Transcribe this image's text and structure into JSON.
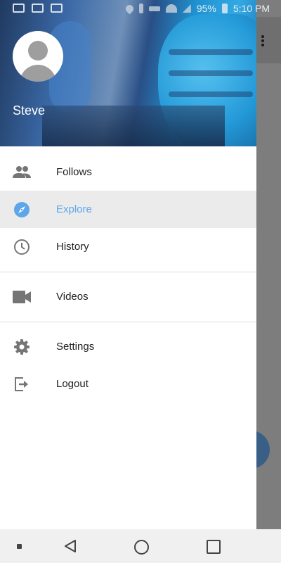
{
  "status_bar": {
    "battery": "95%",
    "time": "5:10 PM",
    "left_icons": [
      "cast-icon",
      "youtube-icon",
      "activity-icon"
    ],
    "right_icons": [
      "location-icon",
      "bluetooth-icon",
      "vpn-key-icon",
      "wifi-icon",
      "signal-icon",
      "battery-icon"
    ]
  },
  "drawer": {
    "user_name": "Steve",
    "menu": [
      {
        "label": "Follows",
        "icon": "people-icon",
        "active": false
      },
      {
        "label": "Explore",
        "icon": "compass-icon",
        "active": true
      },
      {
        "label": "History",
        "icon": "clock-icon",
        "active": false
      },
      {
        "label": "Videos",
        "icon": "videocam-icon",
        "active": false
      },
      {
        "label": "Settings",
        "icon": "gear-icon",
        "active": false
      },
      {
        "label": "Logout",
        "icon": "logout-icon",
        "active": false
      }
    ]
  },
  "colors": {
    "accent": "#5ea6ea",
    "menu_text": "#212121",
    "icon_gray": "#757575",
    "active_bg": "#ebebeb"
  },
  "nav_bar": {
    "buttons": [
      "nav-menu-button",
      "back-button",
      "home-button",
      "recents-button"
    ]
  }
}
